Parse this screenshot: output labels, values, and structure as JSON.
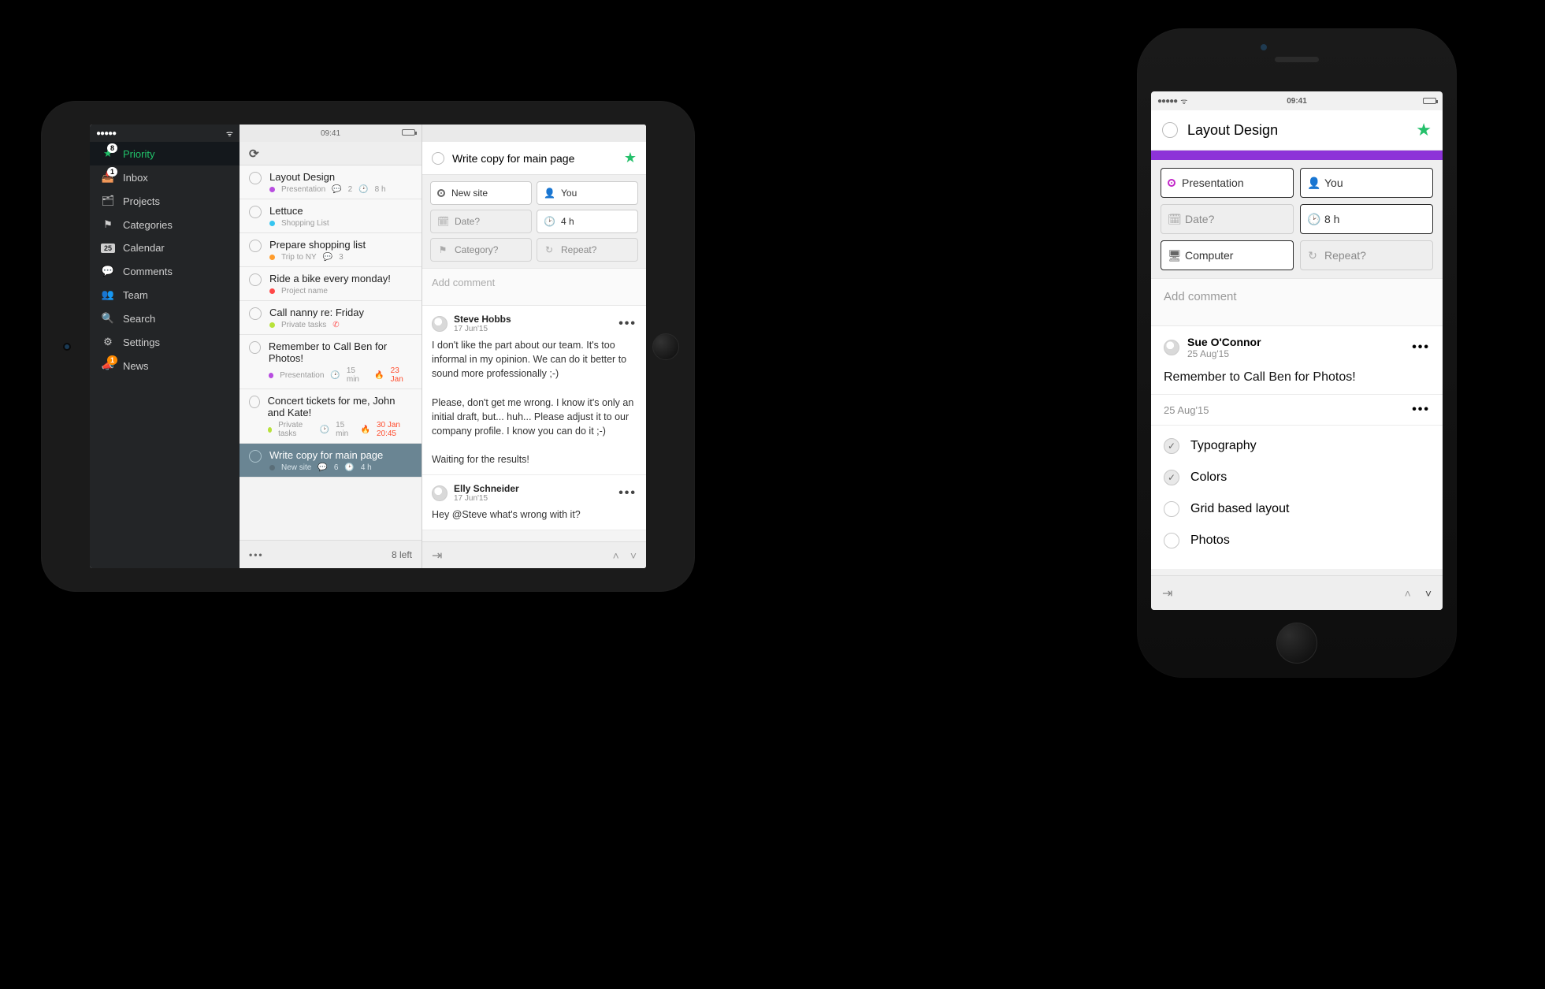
{
  "status": {
    "time": "09:41"
  },
  "sidebar": {
    "items": [
      {
        "label": "Priority",
        "badge": "8"
      },
      {
        "label": "Inbox",
        "badge": "1"
      },
      {
        "label": "Projects"
      },
      {
        "label": "Categories"
      },
      {
        "label": "Calendar",
        "calday": "25"
      },
      {
        "label": "Comments"
      },
      {
        "label": "Team"
      },
      {
        "label": "Search"
      },
      {
        "label": "Settings"
      },
      {
        "label": "News",
        "badge": "1"
      }
    ]
  },
  "tasklist": {
    "footer": "8 left",
    "items": [
      {
        "title": "Layout Design",
        "proj": "Presentation",
        "dot": "#b84de0",
        "extra": [
          "2",
          "8 h"
        ]
      },
      {
        "title": "Lettuce",
        "proj": "Shopping List",
        "dot": "#35c5f0"
      },
      {
        "title": "Prepare shopping list",
        "proj": "Trip to NY",
        "dot": "#ff9c2b",
        "extra": [
          "3"
        ]
      },
      {
        "title": "Ride a bike every monday!",
        "proj": "Project name",
        "dot": "#ff4747"
      },
      {
        "title": "Call nanny re: Friday",
        "proj": "Private tasks",
        "dot": "#b8e23a",
        "extra": [
          "phone"
        ]
      },
      {
        "title": "Remember to Call Ben for Photos!",
        "proj": "Presentation",
        "dot": "#b84de0",
        "extra": [
          "15 min",
          "23 Jan"
        ]
      },
      {
        "title": "Concert tickets for me, John and Kate!",
        "proj": "Private tasks",
        "dot": "#b8e23a",
        "extra": [
          "15 min",
          "30 Jan 20:45"
        ]
      },
      {
        "title": "Write copy for main page",
        "proj": "New site",
        "dot": "#5a6e78",
        "extra": [
          "6",
          "4 h"
        ]
      }
    ]
  },
  "detail": {
    "title": "Write copy for main page",
    "pills": {
      "project": "New site",
      "assignee": "You",
      "date": "Date?",
      "duration": "4 h",
      "category": "Category?",
      "repeat": "Repeat?"
    },
    "add_comment": "Add comment",
    "comments": [
      {
        "name": "Steve Hobbs",
        "date": "17 Jun'15",
        "body": "I don't like the part about our team. It's too informal in my opinion. We can do it better to sound more professionally ;-)\n\nPlease, don't get me wrong. I know it's only an initial draft, but... huh... Please adjust it to our company profile. I know you can do it ;-)\n\nWaiting for the results!"
      },
      {
        "name": "Elly Schneider",
        "date": "17 Jun'15",
        "body": "Hey @Steve what's wrong with it?"
      }
    ]
  },
  "phone": {
    "title": "Layout Design",
    "pills": {
      "project": "Presentation",
      "assignee": "You",
      "date": "Date?",
      "duration": "8 h",
      "category": "Computer",
      "repeat": "Repeat?"
    },
    "add_comment": "Add comment",
    "comment": {
      "name": "Sue O'Connor",
      "date": "25 Aug'15",
      "body": "Remember to Call Ben for Photos!"
    },
    "sub_date": "25 Aug'15",
    "checklist": [
      {
        "label": "Typography",
        "done": true
      },
      {
        "label": "Colors",
        "done": true
      },
      {
        "label": "Grid based layout",
        "done": false
      },
      {
        "label": "Photos",
        "done": false
      }
    ]
  }
}
